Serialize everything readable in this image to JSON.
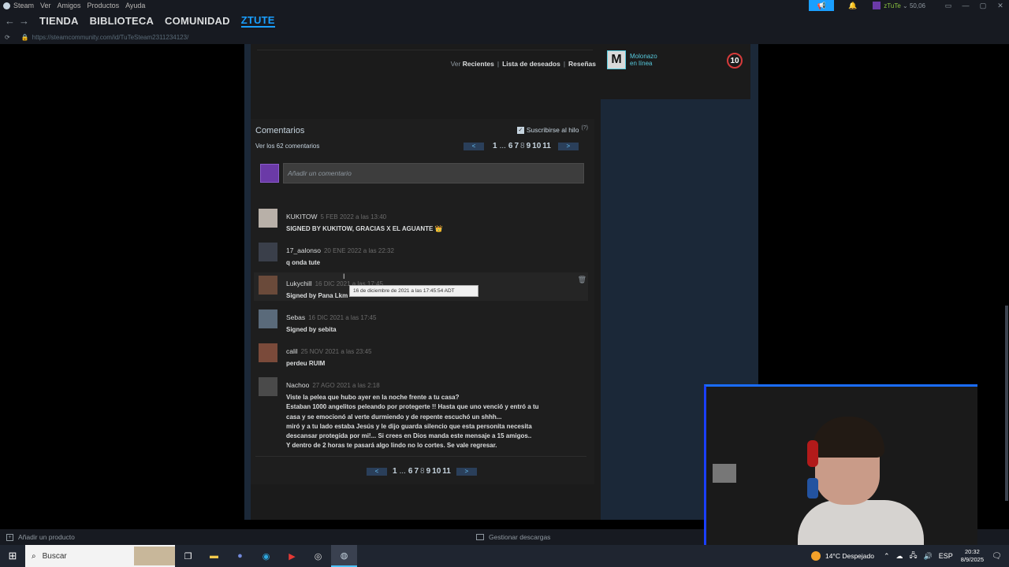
{
  "menu": {
    "items": [
      "Steam",
      "Ver",
      "Amigos",
      "Productos",
      "Ayuda"
    ]
  },
  "account": {
    "name": "zTuTe",
    "wallet": "50,06"
  },
  "nav": {
    "tienda": "TIENDA",
    "biblioteca": "BIBLIOTECA",
    "comunidad": "COMUNIDAD",
    "user": "ZTUTE"
  },
  "url": "https://steamcommunity.com/id/TuTeSteam2311234123/",
  "view_links": {
    "prefix": "Ver",
    "recientes": "Recientes",
    "deseados": "Lista de deseados",
    "resenas": "Reseñas"
  },
  "friend": {
    "name": "Molonazo",
    "status": "en línea",
    "level": "10",
    "avatar_letter": "M"
  },
  "comments_section": {
    "title": "Comentarios",
    "count_text": "Ver los 62 comentarios",
    "subscribe": "Suscribirse al hilo",
    "help": "(?)",
    "placeholder": "Añadir un comentario",
    "pager": {
      "prev": "<",
      "next": ">",
      "first": "1",
      "dots": "...",
      "pages": [
        "6",
        "7",
        "8",
        "9",
        "10",
        "11"
      ],
      "current": "8"
    }
  },
  "comments": [
    {
      "author": "KUKITOW",
      "date": "5 FEB 2022 a las 13:40",
      "text": "SIGNED BY KUKITOW, GRACIAS X EL AGUANTE 👑",
      "avatar_color": "#b8b0a8"
    },
    {
      "author": "17_aalonso",
      "date": "20 ENE 2022 a las 22:32",
      "text": "q onda tute",
      "avatar_color": "#3a3f4a"
    },
    {
      "author": "Lukychill",
      "date": "16 DIC 2021 a las 17:45",
      "text": "Signed by Pana Lkm",
      "avatar_color": "#6a4a3a"
    },
    {
      "author": "Sebas",
      "date": "16 DIC 2021 a las 17:45",
      "text": "Signed by sebita",
      "avatar_color": "#5a6a7a"
    },
    {
      "author": "calil",
      "date": "25 NOV 2021 a las 23:45",
      "text": "perdeu RUIM",
      "avatar_color": "#7a4a3a"
    },
    {
      "author": "Nachoo",
      "date": "27 AGO 2021 a las 2:18",
      "text_lines": [
        "Viste la pelea que hubo ayer en la noche frente a tu casa?",
        "Estaban 1000 angelitos peleando por protegerte !! Hasta que uno venció y entró a tu",
        "casa y se emocionó al verte durmiendo y de repente escuchó un shhh...",
        "miró y a tu lado estaba Jesús y le dijo guarda silencio que esta personita necesita",
        "descansar protegida por mi!... Si crees en Dios manda este mensaje a 15 amigos..",
        "Y dentro de 2 horas te pasará algo lindo no lo cortes. Se vale regresar."
      ],
      "avatar_color": "#4a4a4a"
    }
  ],
  "tooltip": "16 de diciembre de 2021 a las 17:45:54 ADT",
  "bottom": {
    "add_product": "Añadir un producto",
    "downloads": "Gestionar descargas"
  },
  "taskbar": {
    "search": "Buscar",
    "weather": "14°C  Despejado",
    "lang": "ESP",
    "time": "20:32",
    "date": "8/9/2025",
    "notifications": "5"
  },
  "colors": {
    "accent": "#1a9fff",
    "online": "#57cbde",
    "level_ring": "#d63b3b"
  }
}
